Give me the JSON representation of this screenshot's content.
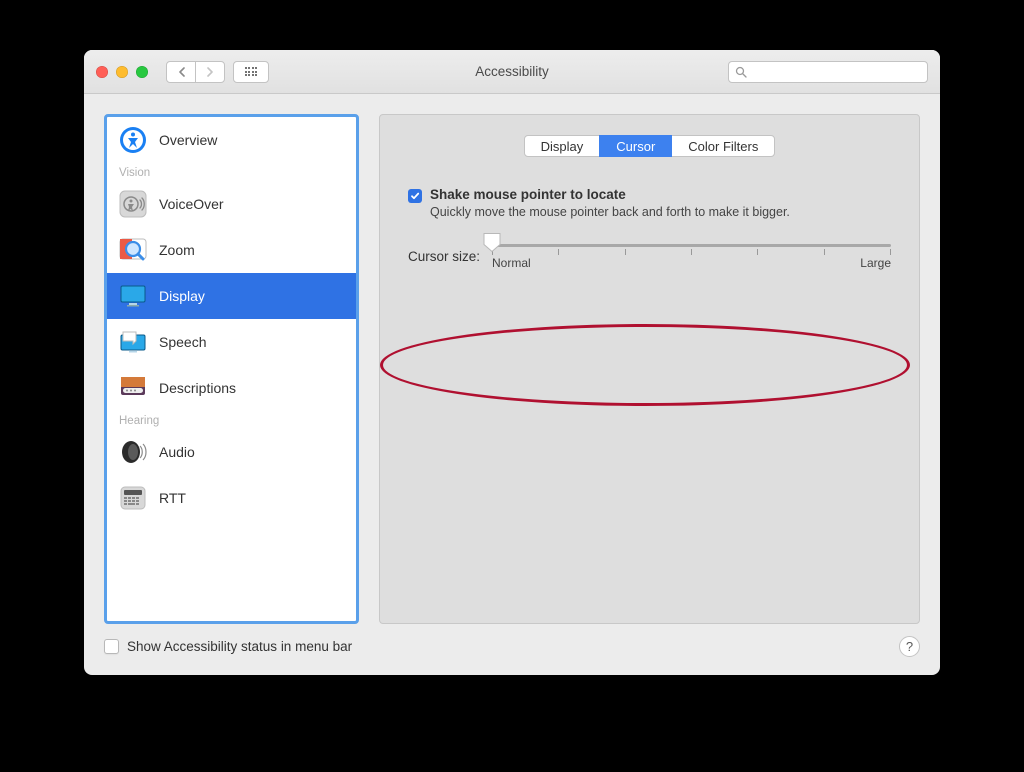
{
  "window": {
    "title": "Accessibility"
  },
  "search": {
    "placeholder": ""
  },
  "sidebar": {
    "items": [
      {
        "label": "Overview"
      }
    ],
    "cat_vision": "Vision",
    "vision_items": [
      {
        "label": "VoiceOver"
      },
      {
        "label": "Zoom"
      },
      {
        "label": "Display"
      },
      {
        "label": "Speech"
      },
      {
        "label": "Descriptions"
      }
    ],
    "cat_hearing": "Hearing",
    "hearing_items": [
      {
        "label": "Audio"
      },
      {
        "label": "RTT"
      }
    ]
  },
  "tabs": [
    {
      "label": "Display",
      "active": false
    },
    {
      "label": "Cursor",
      "active": true
    },
    {
      "label": "Color Filters",
      "active": false
    }
  ],
  "option": {
    "checked": true,
    "label": "Shake mouse pointer to locate",
    "description": "Quickly move the mouse pointer back and forth to make it bigger."
  },
  "slider": {
    "label": "Cursor size:",
    "min_label": "Normal",
    "max_label": "Large"
  },
  "footer": {
    "checked": false,
    "label": "Show Accessibility status in menu bar",
    "help": "?"
  }
}
